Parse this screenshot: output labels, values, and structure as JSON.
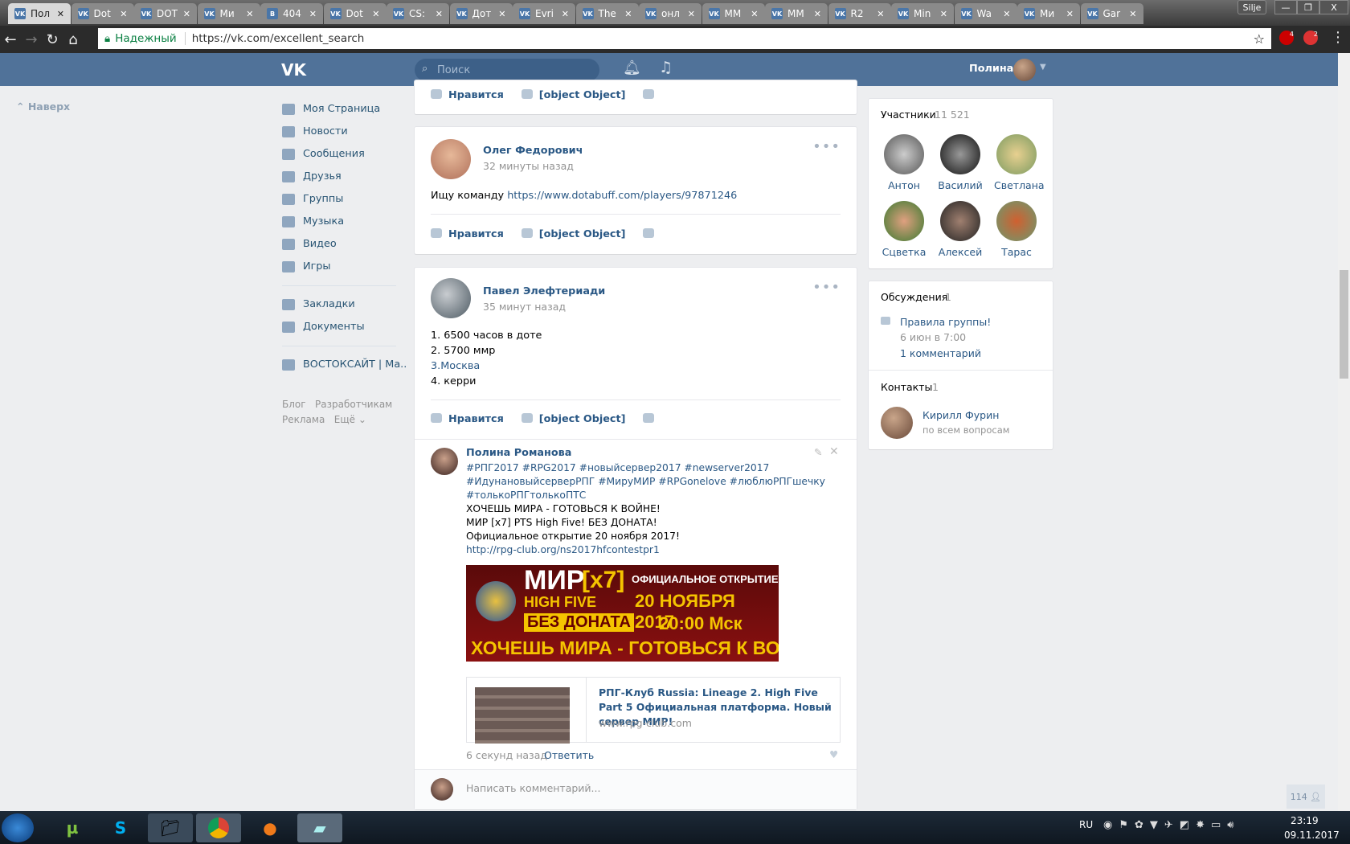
{
  "browser": {
    "tabs": [
      {
        "label": "Пол"
      },
      {
        "label": "Dot"
      },
      {
        "label": "DOT"
      },
      {
        "label": "Ми"
      },
      {
        "label": "404",
        "fav": "B"
      },
      {
        "label": "Dot"
      },
      {
        "label": "CS:"
      },
      {
        "label": "Дот"
      },
      {
        "label": "Evri"
      },
      {
        "label": "The"
      },
      {
        "label": "онл"
      },
      {
        "label": "MM"
      },
      {
        "label": "MM"
      },
      {
        "label": "R2"
      },
      {
        "label": "Min"
      },
      {
        "label": "Wa"
      },
      {
        "label": "Ми"
      },
      {
        "label": "Gar"
      }
    ],
    "tab_close": "✕",
    "vk_fav": "VK",
    "profile_btn": "Silje",
    "minimize": "—",
    "restore": "❐",
    "close": "X",
    "secure_label": "Надежный",
    "url": "https://vk.com/excellent_search",
    "ext_badges": [
      "4",
      "2"
    ]
  },
  "vk": {
    "logo": "VK",
    "search_placeholder": "Поиск",
    "user_name": "Полина",
    "back_to_top": "Наверх",
    "menu": [
      {
        "label": "Моя Страница"
      },
      {
        "label": "Новости"
      },
      {
        "label": "Сообщения"
      },
      {
        "label": "Друзья"
      },
      {
        "label": "Группы"
      },
      {
        "label": "Музыка"
      },
      {
        "label": "Видео"
      },
      {
        "label": "Игры"
      }
    ],
    "menu2": [
      {
        "label": "Закладки"
      },
      {
        "label": "Документы"
      }
    ],
    "menu_group": "ВОСТОКСАЙТ | Ма..",
    "footer_links": [
      "Блог",
      "Разработчикам",
      "Реклама",
      "Ещё ⌄"
    ],
    "like": "Нравится",
    "comment": {
      "author": "Полина Романова",
      "hashtags": [
        "#РПГ2017 #RPG2017 #новыйсервер2017 #newserver2017",
        "#ИдунановыйсерверРПГ #МируМИР #RPGonelove #люблюРПГшечку",
        "#толькоРПГтолькоПТС"
      ],
      "lines": [
        "ХОЧЕШЬ МИРА - ГОТОВЬСЯ К ВОЙНЕ!",
        "МИР [x7] PTS High Five! БЕЗ ДОНАТА!",
        "Официальное открытие 20 ноября 2017!"
      ],
      "url": "http://rpg-club.org/ns2017hfcontestpr1",
      "banner": {
        "t1": "МИР",
        "t2": "[x7]",
        "t3": "HIGH FIVE",
        "t4": "БЕЗ ДОНАТА",
        "t5": "ОФИЦИАЛЬНОЕ ОТКРЫТИЕ",
        "t6": "20 НОЯБРЯ 2017",
        "t7": "20:00 Мск",
        "t8": "ХОЧЕШЬ МИРА - ГОТОВЬСЯ К ВОЙНЕ"
      },
      "snippet_title": "РПГ-Клуб Russia: Lineage 2. High Five Part 5 Официальная платформа. Новый сервер МИР!",
      "snippet_domain": "www.rpg-club.com",
      "time": "6 секунд назад",
      "reply": "Ответить"
    },
    "posts": [
      {
        "author": "Олег Федорович",
        "time": "32 минуты назад",
        "text": "Ищу команду ",
        "link": "https://www.dotabuff.com/players/97871246"
      },
      {
        "author": "Павел Элефтериади",
        "time": "35 минут назад",
        "lines": [
          "1. 6500 часов в доте",
          "2. 5700 ммр",
          "3.Москва",
          "4. керри"
        ]
      }
    ],
    "write_comment_placeholder": "Написать комментарий...",
    "members": {
      "title": "Участники",
      "count": "11 521",
      "list": [
        "Антон",
        "Василий",
        "Светлана",
        "Сцветка",
        "Алексей",
        "Тарас"
      ]
    },
    "discussions": {
      "title": "Обсуждения",
      "count": "1",
      "topic": "Правила группы!",
      "date": "6 июн в 7:00",
      "comments": "1 комментарий"
    },
    "contacts": {
      "title": "Контакты",
      "count": "1",
      "name": "Кирилл Фурин",
      "role": "по всем вопросам"
    },
    "online_count": "114"
  },
  "taskbar": {
    "lang": "RU",
    "time": "23:19",
    "date": "09.11.2017"
  }
}
